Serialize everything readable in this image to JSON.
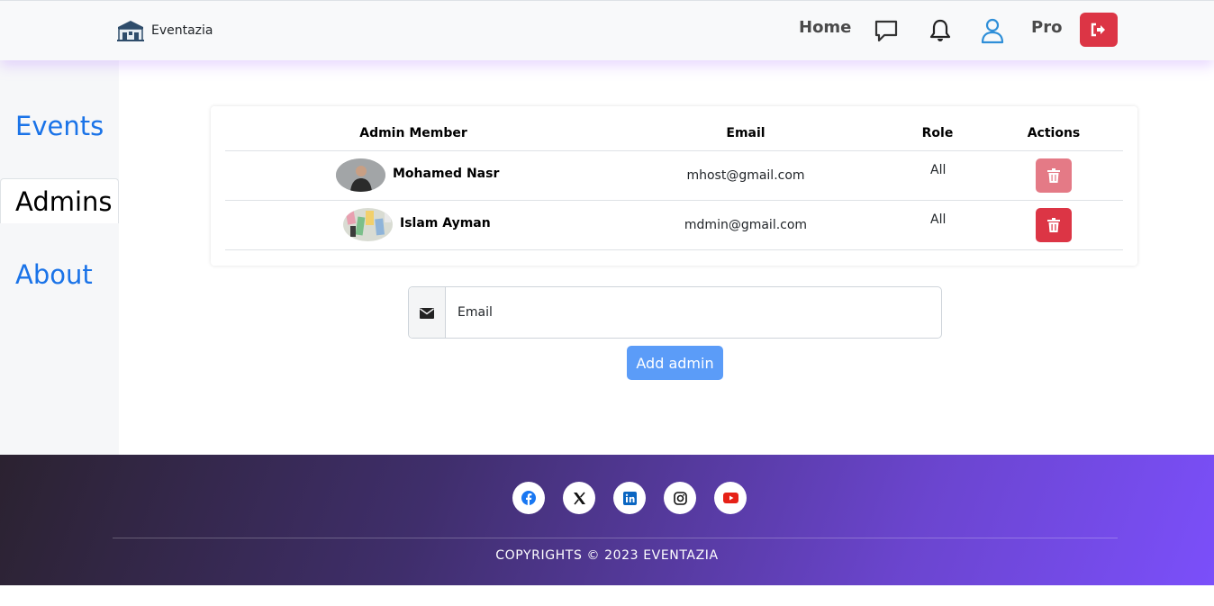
{
  "navbar": {
    "brand_name": "Eventazia",
    "home_label": "Home",
    "pro_label": "Pro",
    "icons": [
      "chat-icon",
      "bell-icon",
      "user-icon",
      "logout-icon"
    ]
  },
  "sidebar": {
    "items": [
      {
        "label": "Events",
        "active": false
      },
      {
        "label": "Admins",
        "active": true
      },
      {
        "label": "About",
        "active": false
      }
    ]
  },
  "admins_table": {
    "headers": [
      "Admin Member",
      "Email",
      "Role",
      "Actions"
    ],
    "rows": [
      {
        "name": "Mohamed Nasr",
        "email": "mhost@gmail.com",
        "role": "All"
      },
      {
        "name": "Islam Ayman",
        "email": "mdmin@gmail.com",
        "role": "All"
      }
    ]
  },
  "add_admin": {
    "email_placeholder": "Email",
    "button_label": "Add admin"
  },
  "footer": {
    "socials": [
      "facebook-icon",
      "x-icon",
      "linkedin-icon",
      "instagram-icon",
      "youtube-icon"
    ],
    "copyright": "COPYRIGHTS © 2023 EVENTAZIA"
  },
  "colors": {
    "danger": "#dc3545",
    "link_blue": "#1a73e8",
    "primary_light": "#5b9cf8",
    "footer_gradient_end": "#7b4ffa"
  }
}
